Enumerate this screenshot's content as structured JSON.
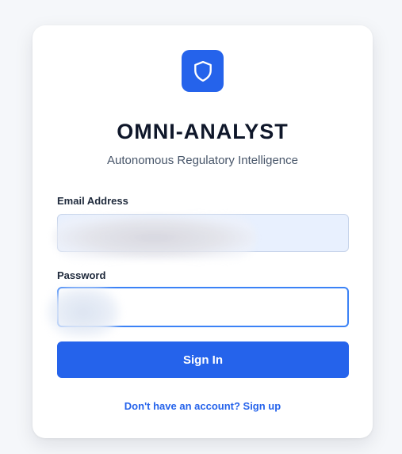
{
  "app": {
    "title": "OMNI-ANALYST",
    "subtitle": "Autonomous Regulatory Intelligence",
    "logo_icon": "shield-icon"
  },
  "form": {
    "email_label": "Email Address",
    "email_value": "",
    "email_placeholder": "",
    "password_label": "Password",
    "password_value": "",
    "password_placeholder": "",
    "submit_label": "Sign In",
    "signup_link": "Don't have an account? Sign up"
  },
  "colors": {
    "accent": "#2563eb",
    "background": "#f5f7fa",
    "card": "#ffffff",
    "title_text": "#0f172a",
    "subtitle_text": "#475569",
    "email_field_bg": "#e8f0fe",
    "focus_border": "#3b82f6"
  }
}
